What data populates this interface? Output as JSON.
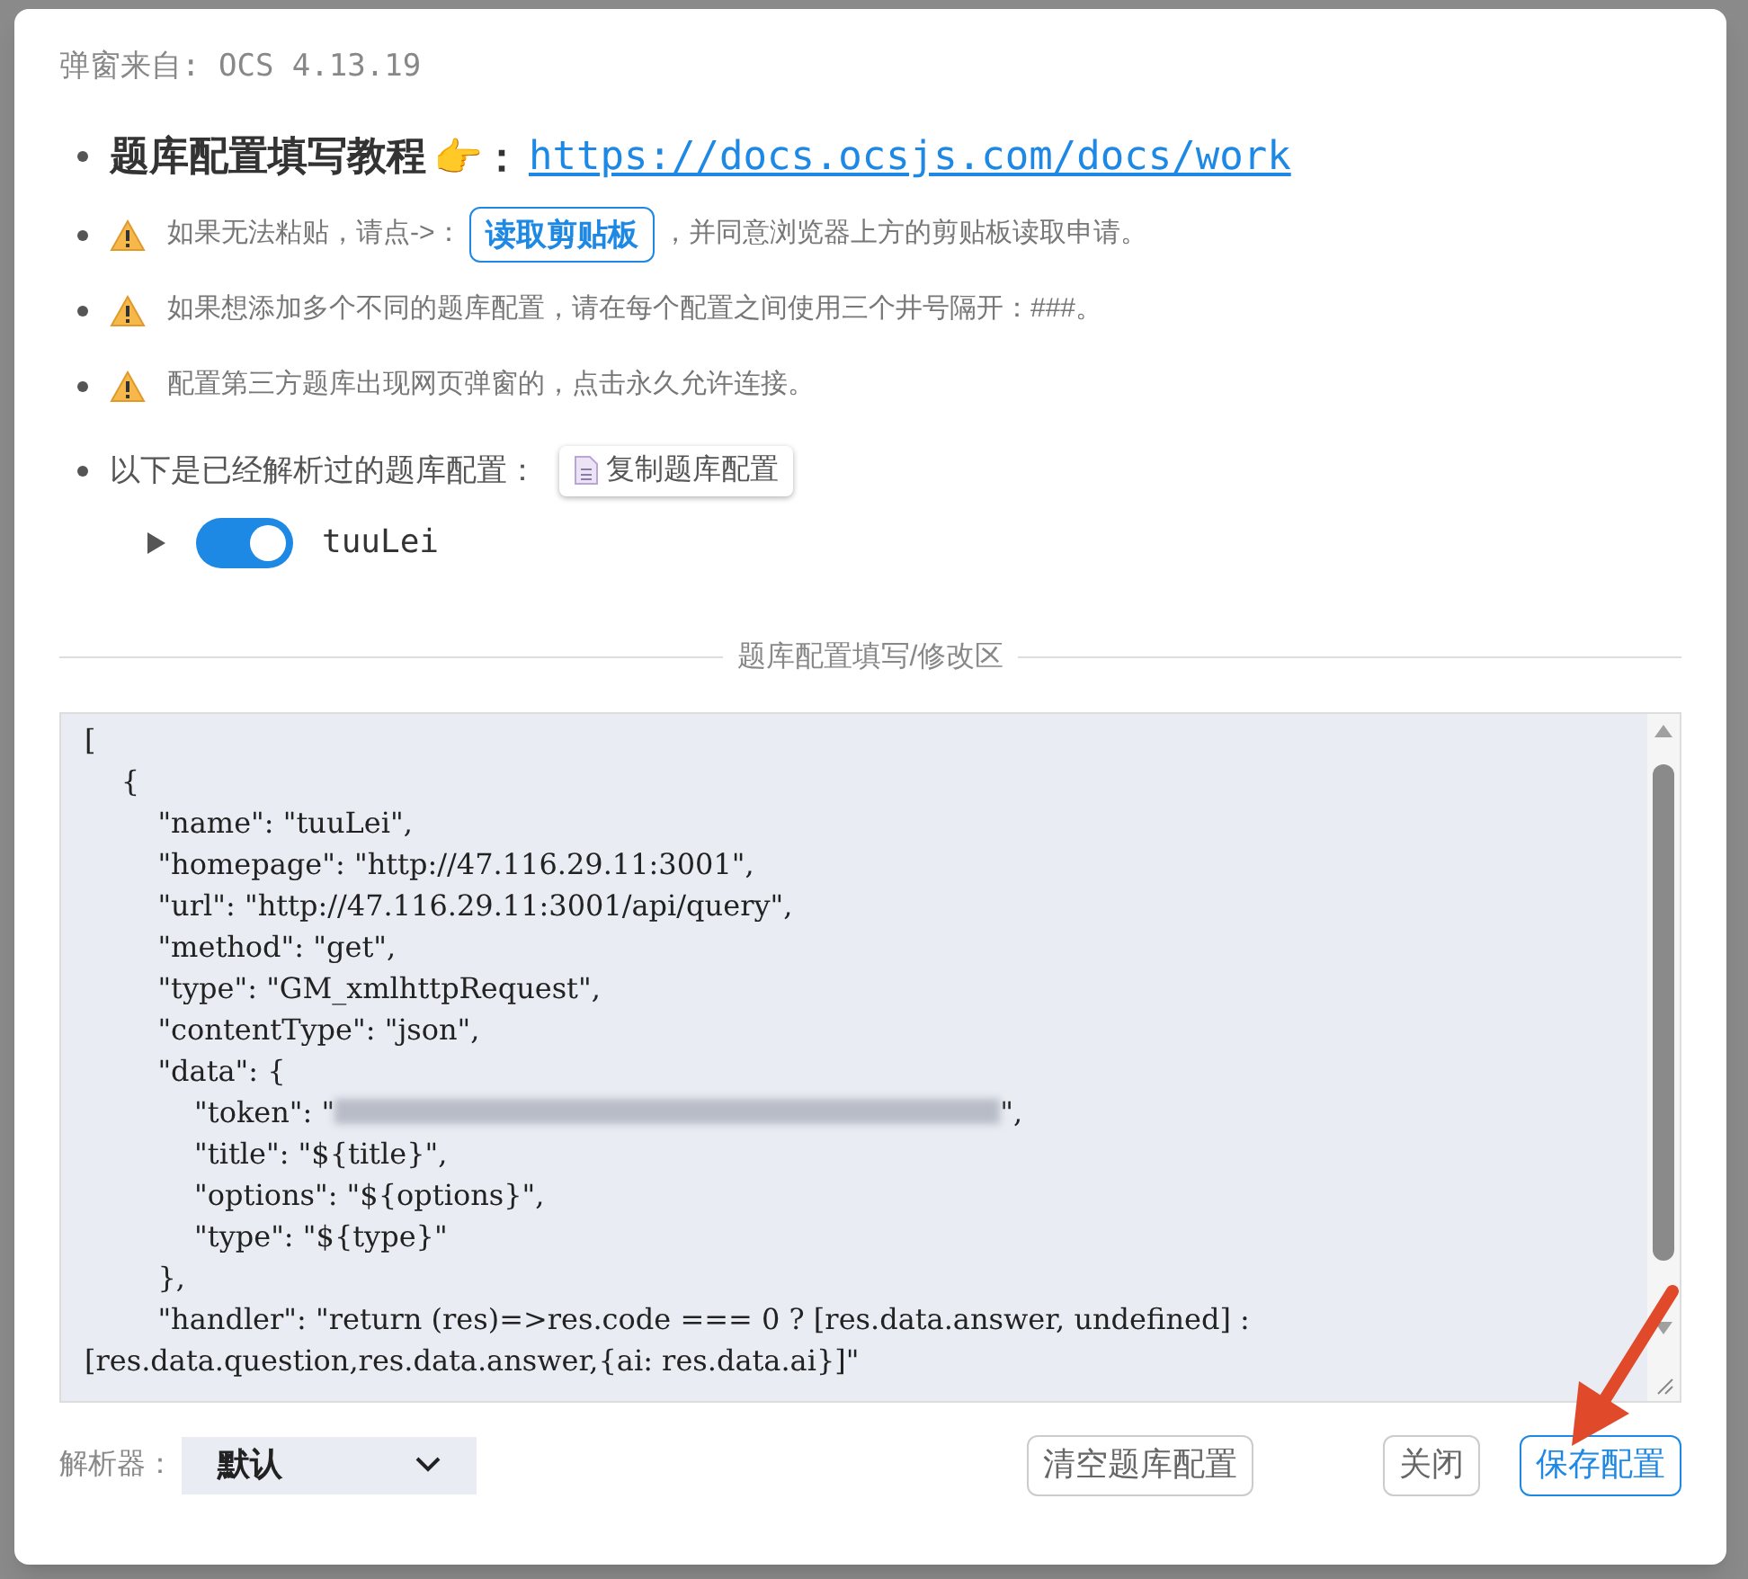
{
  "dialog": {
    "source": "弹窗来自: OCS 4.13.19",
    "tutorial": {
      "label": "题库配置填写教程",
      "emoji": "👉",
      "colon": "：",
      "link": "https://docs.ocsjs.com/docs/work"
    },
    "notes": [
      {
        "kind": "clipboard",
        "before": "如果无法粘贴，请点->：",
        "button": "读取剪贴板",
        "after": "，并同意浏览器上方的剪贴板读取申请。"
      },
      {
        "kind": "text",
        "text": "如果想添加多个不同的题库配置，请在每个配置之间使用三个井号隔开：###。"
      },
      {
        "kind": "text",
        "text": "配置第三方题库出现网页弹窗的，点击永久允许连接。"
      }
    ],
    "parsed": {
      "label": "以下是已经解析过的题库配置：",
      "copy_button": "复制题库配置",
      "items": [
        {
          "name": "tuuLei",
          "expanded": false,
          "on": true
        }
      ]
    },
    "divider_label": "题库配置填写/修改区",
    "editor": {
      "lines": [
        {
          "kind": "text",
          "text": "["
        },
        {
          "kind": "text",
          "text": "    {"
        },
        {
          "kind": "text",
          "text": "        \"name\": \"tuuLei\","
        },
        {
          "kind": "text",
          "text": "        \"homepage\": \"http://47.116.29.11:3001\","
        },
        {
          "kind": "text",
          "text": "        \"url\": \"http://47.116.29.11:3001/api/query\","
        },
        {
          "kind": "text",
          "text": "        \"method\": \"get\","
        },
        {
          "kind": "text",
          "text": "        \"type\": \"GM_xmlhttpRequest\","
        },
        {
          "kind": "text",
          "text": "        \"contentType\": \"json\","
        },
        {
          "kind": "text",
          "text": "        \"data\": {"
        },
        {
          "kind": "redacted",
          "before": "            \"token\": \"",
          "after": "\","
        },
        {
          "kind": "text",
          "text": "            \"title\": \"${title}\","
        },
        {
          "kind": "text",
          "text": "            \"options\": \"${options}\","
        },
        {
          "kind": "text",
          "text": "            \"type\": \"${type}\""
        },
        {
          "kind": "text",
          "text": "        },"
        },
        {
          "kind": "text",
          "text": "        \"handler\": \"return (res)=>res.code === 0 ? [res.data.answer, undefined] :\n[res.data.question,res.data.answer,{ai: res.data.ai}]\""
        }
      ]
    },
    "footer": {
      "parser_label": "解析器：",
      "parser_value": "默认",
      "buttons": [
        {
          "label": "清空题库配置",
          "kind": "default"
        },
        {
          "label": "关闭",
          "kind": "default"
        },
        {
          "label": "保存配置",
          "kind": "primary"
        }
      ]
    }
  }
}
